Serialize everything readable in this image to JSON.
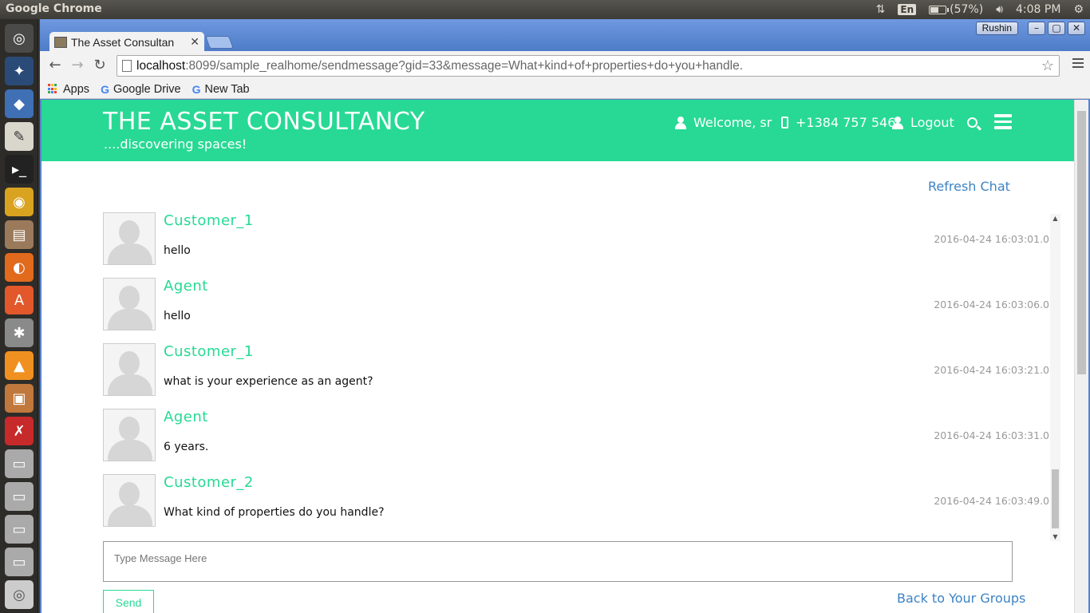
{
  "os": {
    "app_title": "Google Chrome",
    "keyboard": "En",
    "battery": "(57%)",
    "battery_level": 0.57,
    "clock": "4:08 PM"
  },
  "browser": {
    "tab_title": "The Asset Consultan",
    "profile": "Rushin",
    "url_host": "localhost",
    "url_rest": ":8099/sample_realhome/sendmessage?gid=33&message=What+kind+of+properties+do+you+handle.",
    "bookmarks": [
      "Apps",
      "Google Drive",
      "New Tab"
    ]
  },
  "header": {
    "brand": "THE ASSET CONSULTANCY",
    "tagline": "....discovering spaces!",
    "welcome": "Welcome, sr",
    "phone": "+1384 757 546",
    "logout": "Logout"
  },
  "chat": {
    "refresh": "Refresh Chat",
    "messages": [
      {
        "sender": "Customer_1",
        "text": "hello",
        "time": "2016-04-24 16:03:01.0"
      },
      {
        "sender": "Agent",
        "text": "hello",
        "time": "2016-04-24 16:03:06.0"
      },
      {
        "sender": "Customer_1",
        "text": "what is your experience as an agent?",
        "time": "2016-04-24 16:03:21.0"
      },
      {
        "sender": "Agent",
        "text": "6 years.",
        "time": "2016-04-24 16:03:31.0"
      },
      {
        "sender": "Customer_2",
        "text": "What kind of properties do you handle?",
        "time": "2016-04-24 16:03:49.0"
      }
    ],
    "input_placeholder": "Type Message Here",
    "send": "Send",
    "back": "Back to Your Groups"
  },
  "colors": {
    "brand_green": "#27d994",
    "link_blue": "#3c83c4"
  }
}
